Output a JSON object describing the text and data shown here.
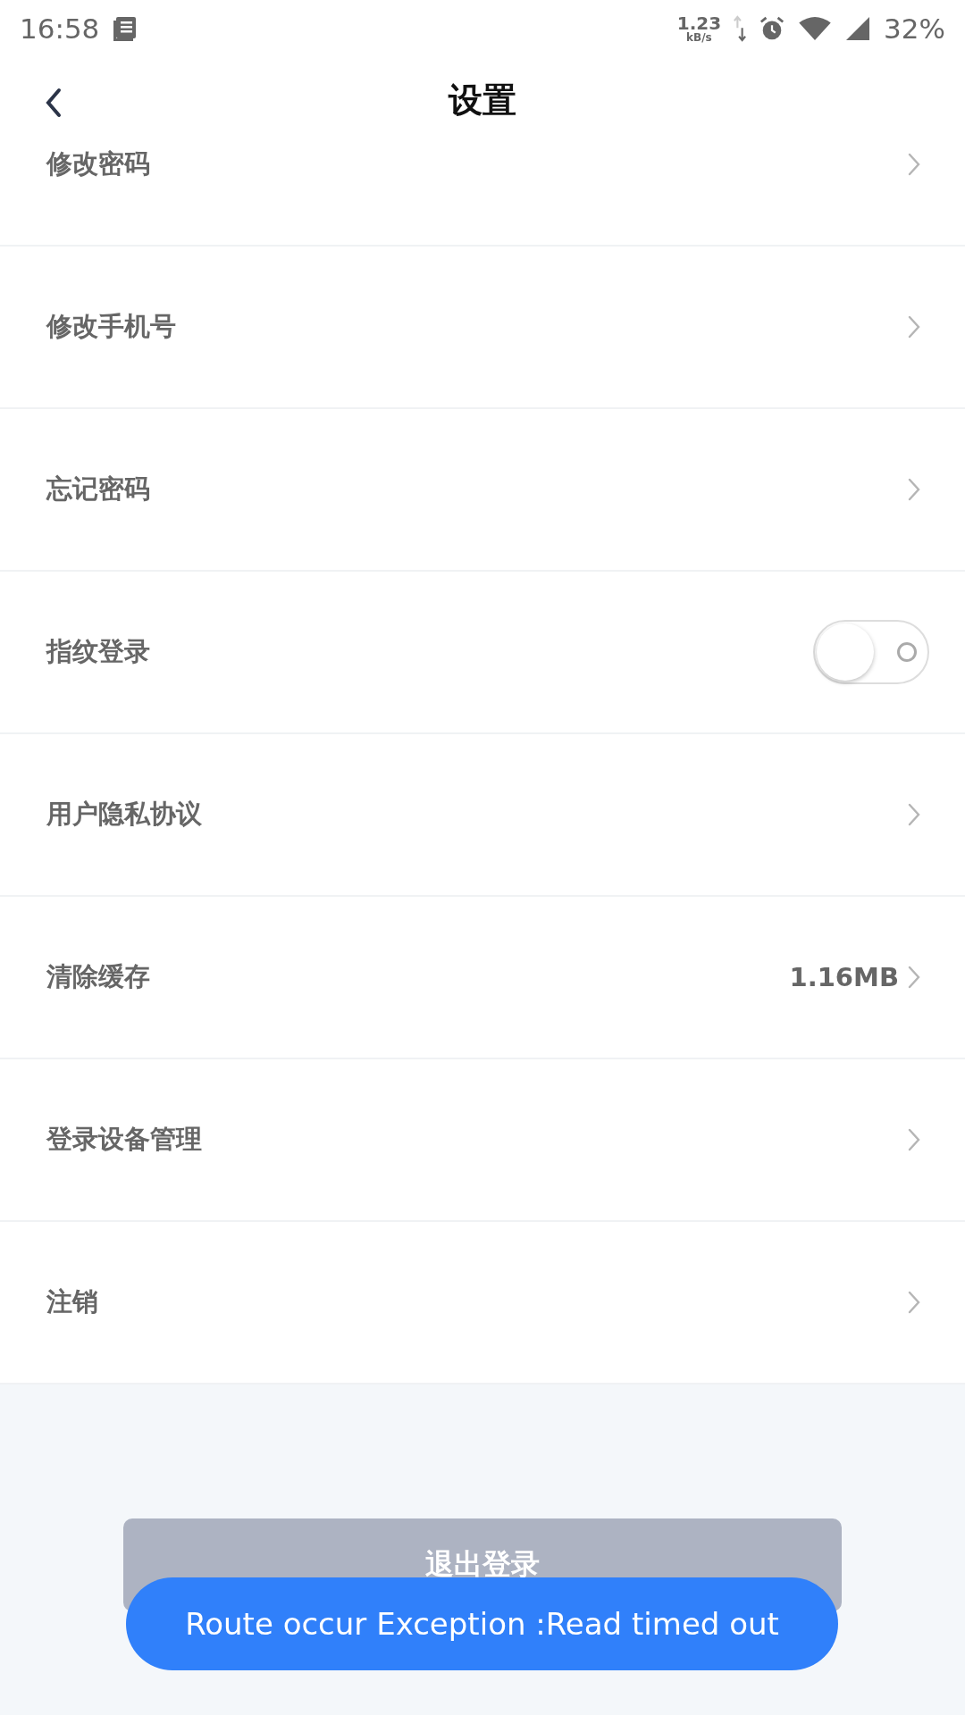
{
  "status_bar": {
    "time": "16:58",
    "speed": "1.23",
    "speed_unit": "kB/s",
    "battery": "32%"
  },
  "header": {
    "title": "设置"
  },
  "rows": [
    {
      "kind": "link",
      "label": "修改密码"
    },
    {
      "kind": "link",
      "label": "修改手机号"
    },
    {
      "kind": "link",
      "label": "忘记密码"
    },
    {
      "kind": "toggle",
      "label": "指纹登录",
      "on": false
    },
    {
      "kind": "link",
      "label": "用户隐私协议"
    },
    {
      "kind": "link",
      "label": "清除缓存",
      "value": "1.16MB"
    },
    {
      "kind": "link",
      "label": "登录设备管理"
    },
    {
      "kind": "link",
      "label": "注销"
    }
  ],
  "logout_button": {
    "label": "退出登录"
  },
  "toast": {
    "text": "Route occur Exception :Read timed out"
  }
}
